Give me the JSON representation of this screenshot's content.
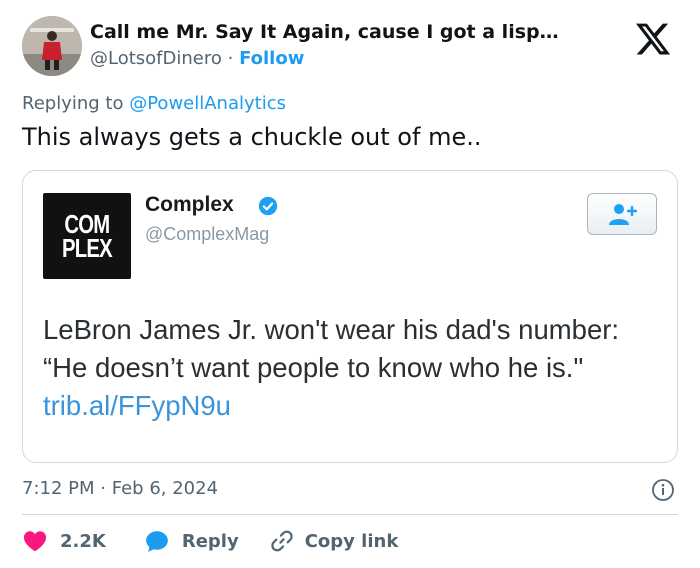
{
  "author": {
    "name": "Call me Mr. Say It Again, cause I got a lisp…",
    "handle": "@LotsofDinero",
    "separator": "·",
    "follow_label": "Follow"
  },
  "platform_icon": "x-logo-icon",
  "replying": {
    "prefix": "Replying to",
    "mention": "@PowellAnalytics"
  },
  "tweet_text": "This always gets a chuckle out of me..",
  "embedded": {
    "logo_line1": "COM",
    "logo_line2": "PLEX",
    "name": "Complex",
    "handle": "@ComplexMag",
    "text": "LeBron James Jr. won't wear his dad's number: “He doesn’t want people to know who he is.\"",
    "link": "trib.al/FFypN9u",
    "verified_icon": "verified-badge-icon",
    "follow_icon": "add-user-icon"
  },
  "timestamp": {
    "time": "7:12 PM",
    "separator": "·",
    "date": "Feb 6, 2024"
  },
  "actions": {
    "likes": "2.2K",
    "reply_label": "Reply",
    "copy_label": "Copy link"
  },
  "colors": {
    "accent": "#1d9bf0",
    "like": "#f91880",
    "muted": "#536471",
    "link": "#3b94d9"
  }
}
